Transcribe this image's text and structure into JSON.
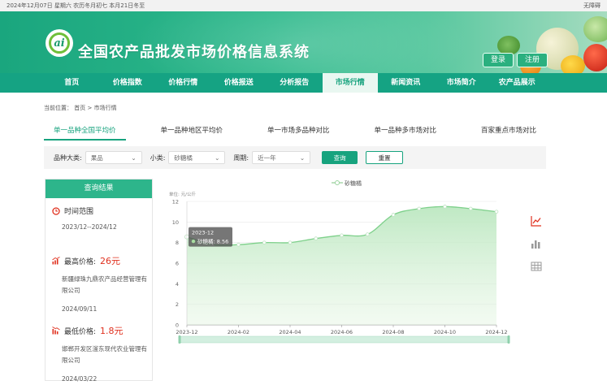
{
  "topbar": {
    "date_text": "2024年12月07日 星期六 农历冬月初七 本月21日冬至",
    "accessibility": "无障碍"
  },
  "header": {
    "logo_text": "ai",
    "title": "全国农产品批发市场价格信息系统",
    "login": "登录",
    "register": "注册"
  },
  "nav": [
    "首页",
    "价格指数",
    "价格行情",
    "价格报送",
    "分析报告",
    "市场行情",
    "新闻资讯",
    "市场简介",
    "农产品展示"
  ],
  "breadcrumb": {
    "label": "当前位置：",
    "home": "首页",
    "sep": ">",
    "current": "市场行情"
  },
  "subtabs": [
    "单一品种全国平均价",
    "单一品种地区平均价",
    "单一市场多品种对比",
    "单一品种多市场对比",
    "百家重点市场对比"
  ],
  "filters": {
    "category_label": "品种大类:",
    "category_value": "果品",
    "subclass_label": "小类:",
    "subclass_value": "砂糖橘",
    "period_label": "周期:",
    "period_value": "近一年",
    "query": "查询",
    "reset": "重置"
  },
  "result": {
    "header": "查询结果",
    "range_label": "时间范围",
    "range_value": "2023/12--2024/12",
    "max_label": "最高价格:",
    "max_value": "26元",
    "max_market": "新疆绿珠九鼎农产品经营管理有限公司",
    "max_date": "2024/09/11",
    "min_label": "最低价格:",
    "min_value": "1.8元",
    "min_market": "邯郸开发区滏东现代农业管理有限公司",
    "min_date": "2024/03/22"
  },
  "colors": {
    "brand": "#17a37e",
    "nav": "#15a383",
    "price_red": "#e0301e",
    "line": "#7dd08a"
  },
  "chart_data": {
    "type": "area",
    "legend": "砂糖橘",
    "legend_position": "top-center",
    "ylabel": "单位: 元/公斤",
    "ylim": [
      0,
      12
    ],
    "yticks": [
      0,
      2,
      4,
      6,
      8,
      10,
      12
    ],
    "xticks": [
      "2023-12",
      "2024-02",
      "2024-04",
      "2024-06",
      "2024-08",
      "2024-10",
      "2024-12"
    ],
    "grid": true,
    "series": [
      {
        "name": "砂糖橘",
        "x": [
          "2023-12",
          "2024-01",
          "2024-02",
          "2024-03",
          "2024-04",
          "2024-05",
          "2024-06",
          "2024-07",
          "2024-08",
          "2024-09",
          "2024-10",
          "2024-11",
          "2024-12"
        ],
        "values": [
          8.56,
          7.8,
          7.8,
          8.0,
          8.0,
          8.4,
          8.7,
          8.8,
          10.7,
          11.3,
          11.5,
          11.3,
          11.0
        ]
      }
    ],
    "tooltip": {
      "title": "2023-12",
      "series": "砂糖橘",
      "value": "8.56"
    }
  }
}
